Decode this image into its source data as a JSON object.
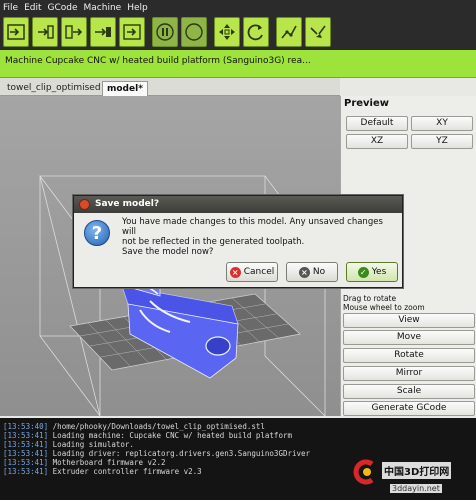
{
  "menu": [
    "File",
    "Edit",
    "GCode",
    "Machine",
    "Help"
  ],
  "toolbar": {
    "icons": [
      "build-to-machine-icon",
      "build-to-file-icon",
      "upload-icon",
      "build-icon",
      "simulate-icon",
      "pause-icon",
      "stop-icon",
      "control-panel-icon",
      "reset-icon",
      "connect-icon",
      "disconnect-icon"
    ]
  },
  "machine": {
    "status": "Machine Cupcake CNC w/ heated build platform (Sanguino3G) rea..."
  },
  "tabs": [
    {
      "label": "towel_clip_optimised"
    },
    {
      "label": "model*"
    }
  ],
  "preview": {
    "title": "Preview",
    "buttons": [
      "Default",
      "XY",
      "XZ",
      "YZ"
    ],
    "hint1": "Drag to rotate",
    "hint2": "Mouse wheel to zoom",
    "actions": [
      "View",
      "Move",
      "Rotate",
      "Mirror",
      "Scale",
      "Generate GCode"
    ]
  },
  "dialog": {
    "title": "Save model?",
    "line1": "You have made changes to this model. Any unsaved changes will",
    "line2": "not be reflected in the generated toolpath.",
    "line3": "Save the model now?",
    "cancel": "Cancel",
    "no": "No",
    "yes": "Yes"
  },
  "console": [
    {
      "ts": "[13:53:40]",
      "text": " /home/phooky/Downloads/towel_clip_optimised.stl"
    },
    {
      "ts": "[13:53:41]",
      "text": " Loading machine: Cupcake CNC w/ heated build platform"
    },
    {
      "ts": "[13:53:41]",
      "text": " Loading simulator."
    },
    {
      "ts": "[13:53:41]",
      "text": " Loading driver: replicatorg.drivers.gen3.Sanguino3GDriver"
    },
    {
      "ts": "[13:53:41]",
      "text": " Motherboard firmware v2.2"
    },
    {
      "ts": "[13:53:41]",
      "text": " Extruder controller firmware v2.3"
    }
  ],
  "watermark": {
    "text": "中国3D打印网",
    "site": "3ddayin.net"
  },
  "colors": {
    "accent": "#9ee33c",
    "console_bg": "#141414",
    "model": "#5560f0"
  }
}
